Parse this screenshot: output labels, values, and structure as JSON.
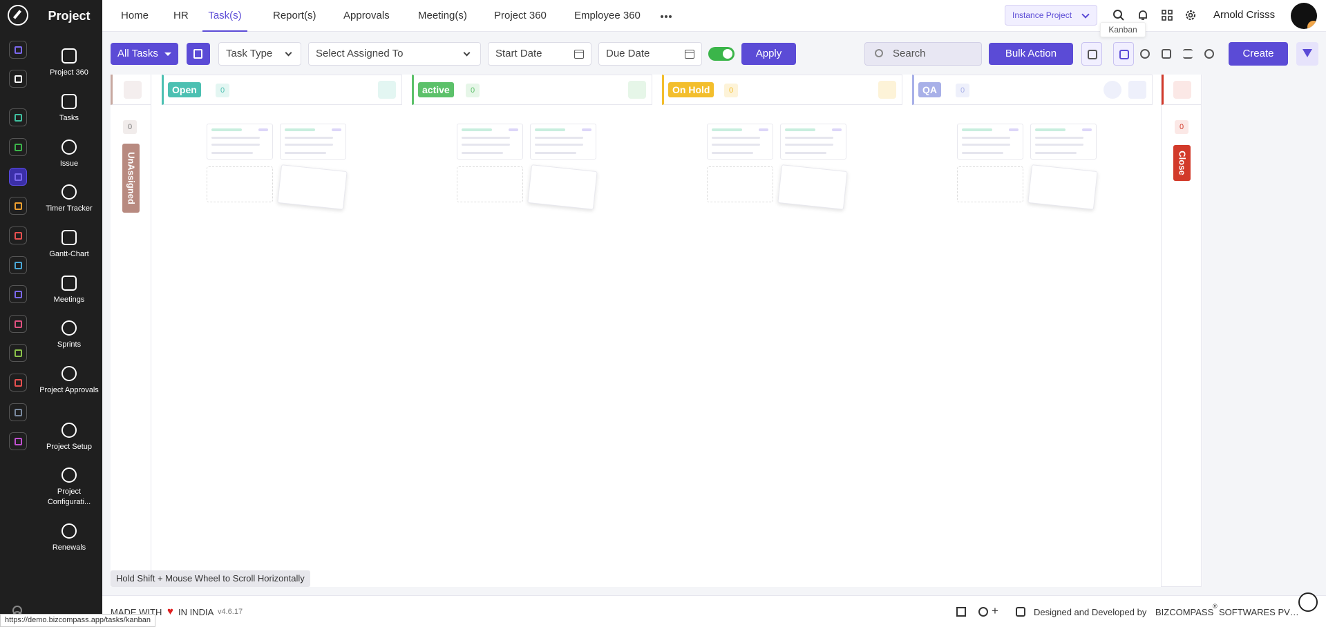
{
  "app": {
    "title": "Project"
  },
  "sidebar": {
    "items": [
      {
        "label": "Project 360"
      },
      {
        "label": "Tasks"
      },
      {
        "label": "Issue"
      },
      {
        "label": "Timer Tracker"
      },
      {
        "label": "Gantt-Chart"
      },
      {
        "label": "Meetings"
      },
      {
        "label": "Sprints"
      },
      {
        "label": "Project Approvals"
      },
      {
        "label": "Project Setup"
      },
      {
        "label": "Project Configurati..."
      },
      {
        "label": "Renewals"
      }
    ]
  },
  "rail": {
    "icon_colors": [
      "#7b68ee",
      "#ffffff",
      "#3fc1a0",
      "#3bb54a",
      "#7b68ee",
      "#f0a030",
      "#e85050",
      "#4aa8d8",
      "#7b68ee",
      "#e05080",
      "#8bc34a",
      "#e85050",
      "#7a8aa0",
      "#c050d0"
    ]
  },
  "nav": {
    "tabs": [
      {
        "label": "Home"
      },
      {
        "label": "HR"
      },
      {
        "label": "Task(s)"
      },
      {
        "label": "Report(s)"
      },
      {
        "label": "Approvals"
      },
      {
        "label": "Meeting(s)"
      },
      {
        "label": "Project 360"
      },
      {
        "label": "Employee 360"
      }
    ],
    "active_tab": "Task(s)",
    "instance_label": "Instance Project",
    "user_name": "Arnold Crisss"
  },
  "toolbar": {
    "all_tasks": "All Tasks",
    "task_type": "Task Type",
    "assigned_to": "Select Assigned To",
    "start_date": "Start Date",
    "due_date": "Due Date",
    "toggle_on": true,
    "apply": "Apply",
    "search_placeholder": "Search",
    "bulk_action": "Bulk Action",
    "create": "Create",
    "tooltip": "Kanban"
  },
  "board": {
    "unassigned": {
      "count": "0",
      "label": "UnAssigned",
      "color": "#b88a80"
    },
    "columns": [
      {
        "name": "Open",
        "count": "0",
        "color": "#4cc0b2"
      },
      {
        "name": "active",
        "count": "0",
        "color": "#5cc16a"
      },
      {
        "name": "On Hold",
        "count": "0",
        "color": "#f3be2c"
      },
      {
        "name": "QA",
        "count": "0",
        "color": "#a8b0e8"
      }
    ],
    "close": {
      "count": "0",
      "label": "Close",
      "color": "#d23a2a"
    }
  },
  "hint": "Hold Shift + Mouse Wheel to Scroll Horizontally",
  "footer": {
    "made_with": "MADE WITH",
    "in_india": "IN INDIA",
    "version": "v4.6.17",
    "designed_by": "Designed and Developed by",
    "company": "BIZCOMPASS",
    "company_suffix": "SOFTWARES PV…"
  },
  "status_url": "https://demo.bizcompass.app/tasks/kanban"
}
